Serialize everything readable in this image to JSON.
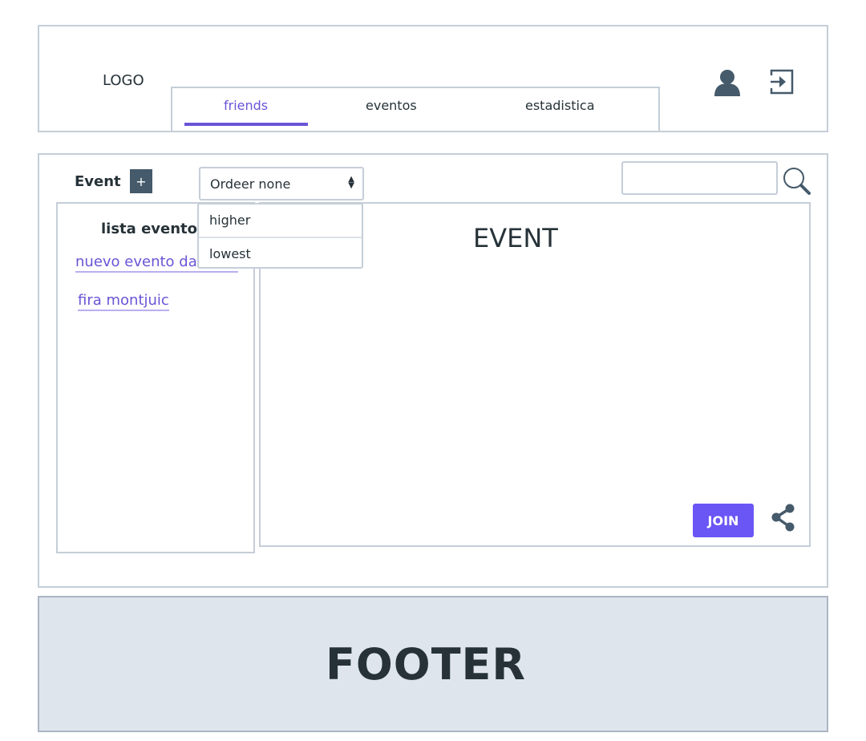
{
  "header": {
    "logo": "LOGO",
    "tabs": [
      {
        "label": "friends",
        "active": true
      },
      {
        "label": "eventos",
        "active": false
      },
      {
        "label": "estadistica",
        "active": false
      }
    ],
    "icons": [
      "user-icon",
      "logout-icon"
    ]
  },
  "toolbar": {
    "event_label": "Event",
    "add_label": "+",
    "order_select": {
      "selected": "Ordeer none",
      "options": [
        "higher",
        "lowest"
      ]
    },
    "search_placeholder": ""
  },
  "event_list": {
    "title": "lista eventos",
    "items": [
      {
        "label": "nuevo evento dat"
      },
      {
        "label": "fira montjuic"
      }
    ]
  },
  "event_panel": {
    "title": "EVENT",
    "join_label": "JOIN"
  },
  "footer": {
    "text": "FOOTER"
  },
  "colors": {
    "accent": "#6a55d6",
    "join_button": "#6a55f5",
    "border": "#c5ced8",
    "dark": "#263238",
    "add_button": "#455a6a",
    "footer_bg": "#dfe5ed"
  }
}
